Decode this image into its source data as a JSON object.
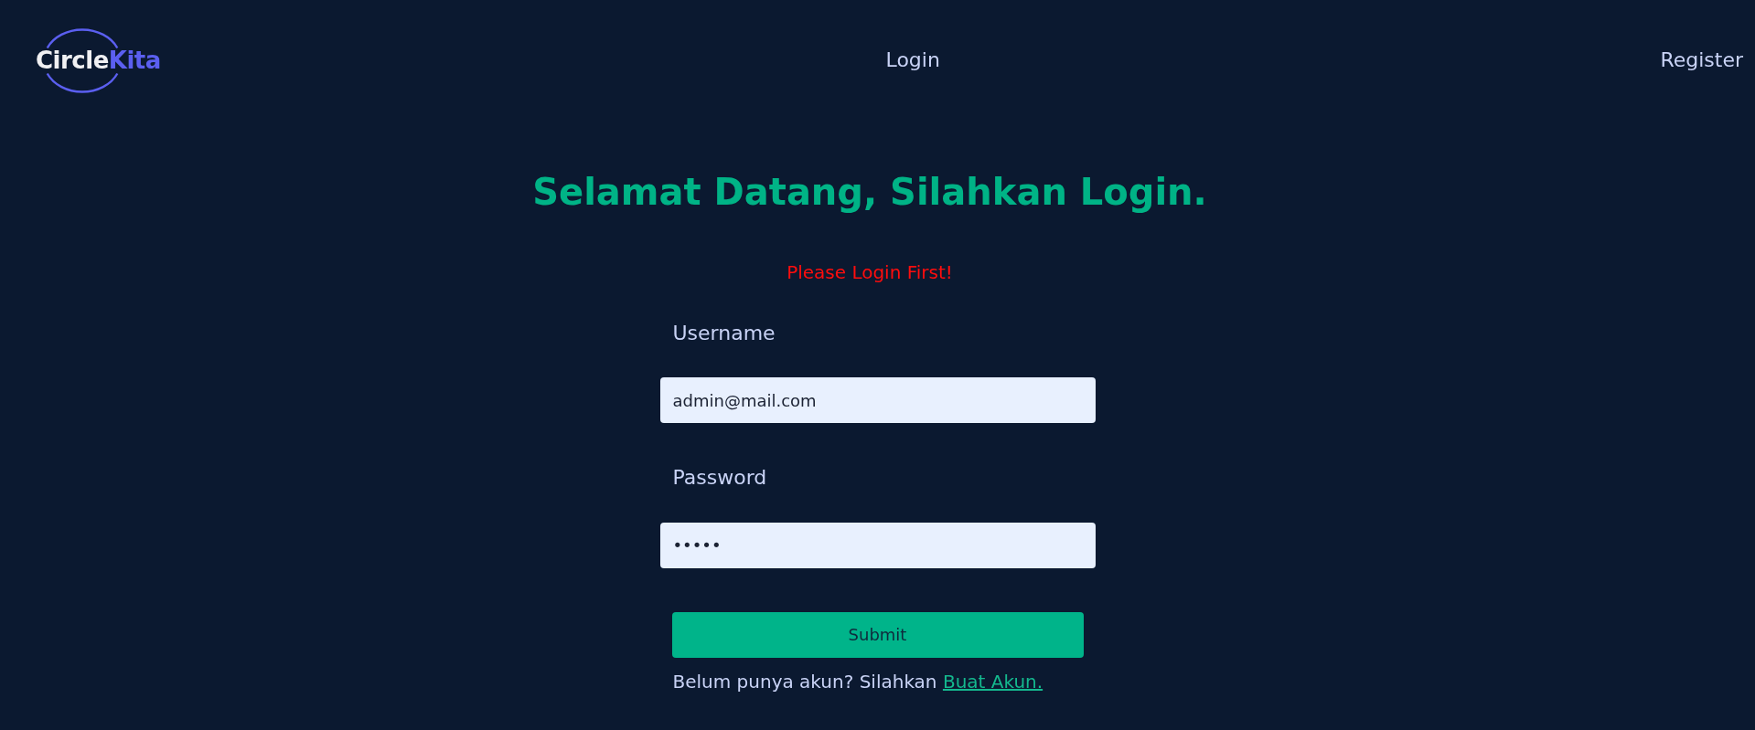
{
  "header": {
    "logo": {
      "parts": [
        {
          "text": "Circle",
          "color": "#f0f0f2"
        },
        {
          "text": "Kita",
          "color": "#5b5ff0"
        }
      ]
    },
    "nav": [
      {
        "label": "Login"
      },
      {
        "label": "Register"
      }
    ]
  },
  "title": "Selamat Datang, Silahkan Login.",
  "alert": "Please Login First!",
  "form": {
    "fields": [
      {
        "label": "Username",
        "value": "admin@mail.com"
      },
      {
        "label": "Password",
        "value": "•••••"
      }
    ],
    "submit": "Submit",
    "footer": {
      "text": "Belum punya akun? Silahkan",
      "link": "Buat Akun."
    }
  }
}
